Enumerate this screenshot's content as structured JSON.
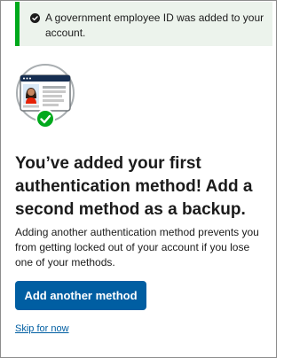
{
  "alert": {
    "message": "A government employee ID was added to your account.",
    "status": "success",
    "icon": "check-circle-icon",
    "colors": {
      "background": "#ecf3ec",
      "border": "#00a91c"
    }
  },
  "illustration": {
    "icon": "id-card-verified-icon"
  },
  "heading": "You’ve added your first authentication method! Add a second method as a backup.",
  "description": "Adding another authentication method prevents you from getting locked out of your account if you lose one of your methods.",
  "actions": {
    "primary_label": "Add another method",
    "skip_label": "Skip for now"
  },
  "colors": {
    "primary": "#005ea2",
    "success": "#00a91c",
    "text": "#1b1b1b"
  }
}
